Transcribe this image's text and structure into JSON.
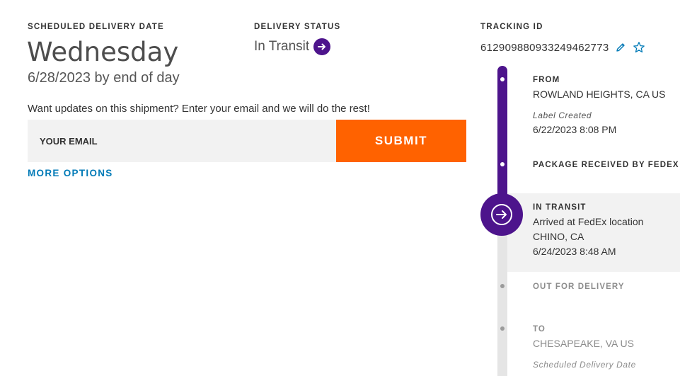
{
  "delivery": {
    "scheduled_label": "SCHEDULED DELIVERY DATE",
    "day": "Wednesday",
    "date": "6/28/2023 by end of day"
  },
  "status": {
    "label": "DELIVERY STATUS",
    "value": "In Transit",
    "icon": "arrow-right-circle-icon"
  },
  "email_updates": {
    "prompt": "Want updates on this shipment? Enter your email and we will do the rest!",
    "placeholder": "YOUR EMAIL",
    "value": "",
    "submit_label": "SUBMIT",
    "more_options": "MORE OPTIONS"
  },
  "tracking": {
    "label": "TRACKING ID",
    "id": "612909880933249462773",
    "edit_icon": "pencil-icon",
    "star_icon": "star-icon"
  },
  "timeline": {
    "from": {
      "title": "FROM",
      "location": "ROWLAND HEIGHTS, CA US",
      "sub_label": "Label Created",
      "datetime": "6/22/2023 8:08 PM"
    },
    "received": {
      "title": "PACKAGE RECEIVED BY FEDEX"
    },
    "in_transit": {
      "title": "IN TRANSIT",
      "event": "Arrived at FedEx location",
      "location": "CHINO, CA",
      "datetime": "6/24/2023 8:48 AM"
    },
    "out_for_delivery": {
      "title": "OUT FOR DELIVERY"
    },
    "to": {
      "title": "TO",
      "location": "CHESAPEAKE, VA US",
      "sub_label": "Scheduled Delivery Date"
    }
  },
  "colors": {
    "fedex_purple": "#4d148c",
    "fedex_orange": "#ff6200",
    "link_blue": "#007ab7",
    "track_gray": "#e5e5e5"
  }
}
